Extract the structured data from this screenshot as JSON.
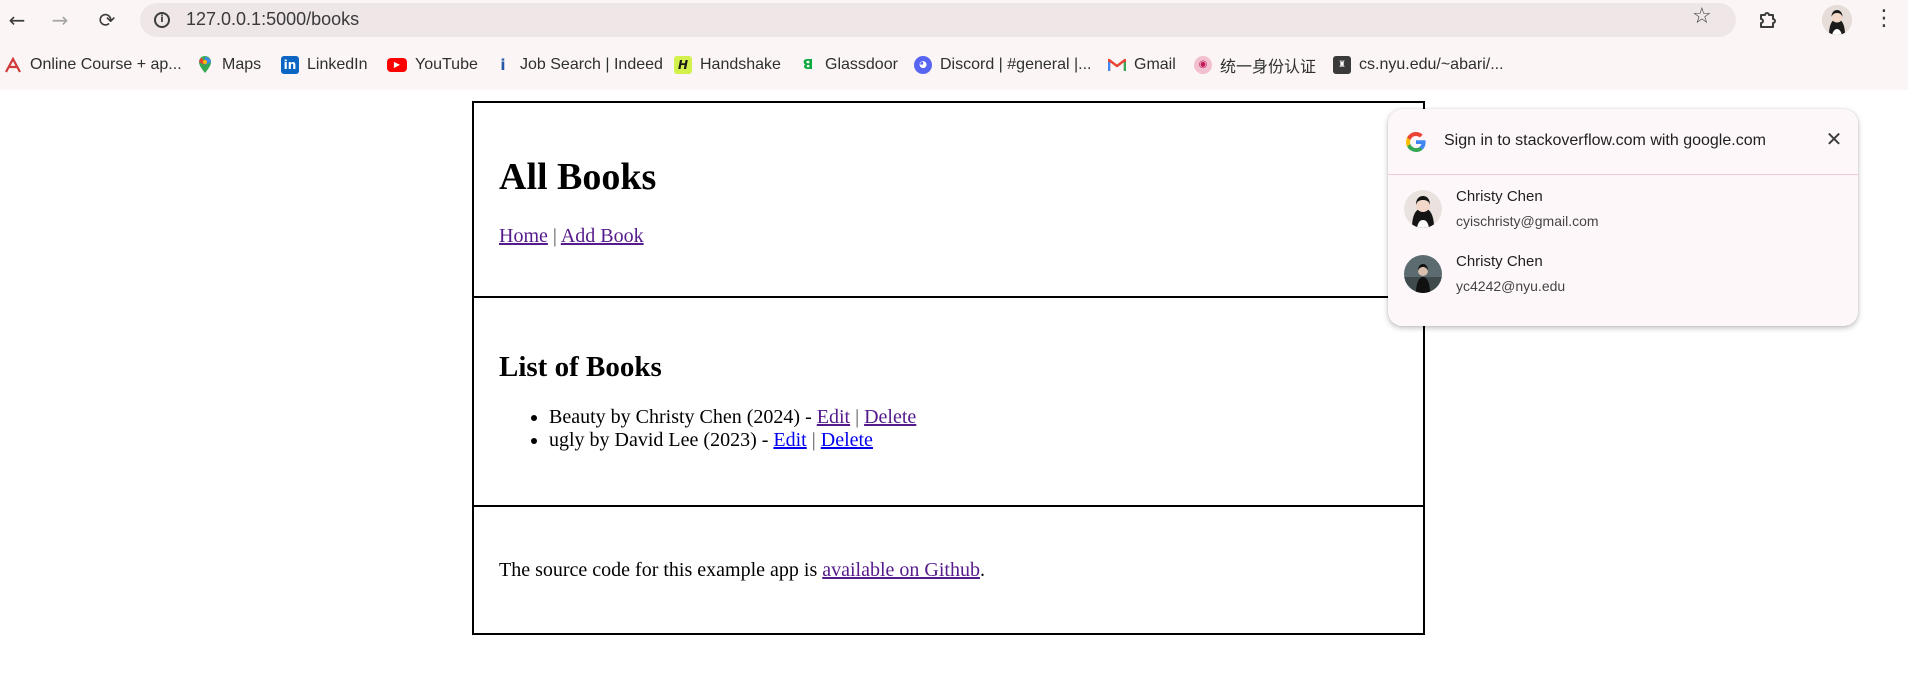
{
  "browser": {
    "back_label": "←",
    "forward_label": "→",
    "reload_label": "⟳",
    "url": "127.0.0.1:5000/books",
    "star_label": "☆",
    "menu_label": "⋮",
    "site_info_label": "i"
  },
  "bookmarks": [
    {
      "label": "Online Course + ap...",
      "icon": "course-icon",
      "color": "#d23b3b"
    },
    {
      "label": "Maps",
      "icon": "maps-icon",
      "color": "#34a853"
    },
    {
      "label": "LinkedIn",
      "icon": "linkedin-icon",
      "color": "#0a66c2"
    },
    {
      "label": "YouTube",
      "icon": "youtube-icon",
      "color": "#ff0000"
    },
    {
      "label": "Job Search | Indeed",
      "icon": "indeed-icon",
      "color": "#2557a7"
    },
    {
      "label": "Handshake",
      "icon": "handshake-icon",
      "color": "#d2f14c"
    },
    {
      "label": "Glassdoor",
      "icon": "glassdoor-icon",
      "color": "#0caa41"
    },
    {
      "label": "Discord | #general |...",
      "icon": "discord-icon",
      "color": "#5865f2"
    },
    {
      "label": "Gmail",
      "icon": "gmail-icon",
      "color": "#ea4335"
    },
    {
      "label": "统一身份认证",
      "icon": "nyu-auth-icon",
      "color": "#c2185b"
    },
    {
      "label": "cs.nyu.edu/~abari/...",
      "icon": "cs-nyu-icon",
      "color": "#3a3a3a"
    }
  ],
  "header": {
    "title": "All Books",
    "home_link": "Home",
    "separator": "|",
    "add_book_link": "Add Book"
  },
  "main": {
    "heading": "List of Books",
    "books": [
      {
        "text": "Beauty by Christy Chen (2024) - ",
        "edit": "Edit",
        "sep": "|",
        "delete": "Delete"
      },
      {
        "text": "ugly by David Lee (2023) - ",
        "edit": "Edit",
        "sep": "|",
        "delete": "Delete"
      }
    ]
  },
  "footer": {
    "text_before": "The source code for this example app is ",
    "link": "available on Github",
    "text_after": "."
  },
  "signin_popup": {
    "title": "Sign in to stackoverflow.com with google.com",
    "close_label": "✕",
    "accounts": [
      {
        "name": "Christy Chen",
        "email": "cyischristy@gmail.com"
      },
      {
        "name": "Christy Chen",
        "email": "yc4242@nyu.edu"
      }
    ]
  },
  "colors": {
    "link_visited": "#551a8b",
    "link_unvisited": "#0000ee",
    "chrome_bg": "#fbf6f5",
    "omnibox_bg": "#efe6e8",
    "popup_divider": "#f2c8d6"
  }
}
